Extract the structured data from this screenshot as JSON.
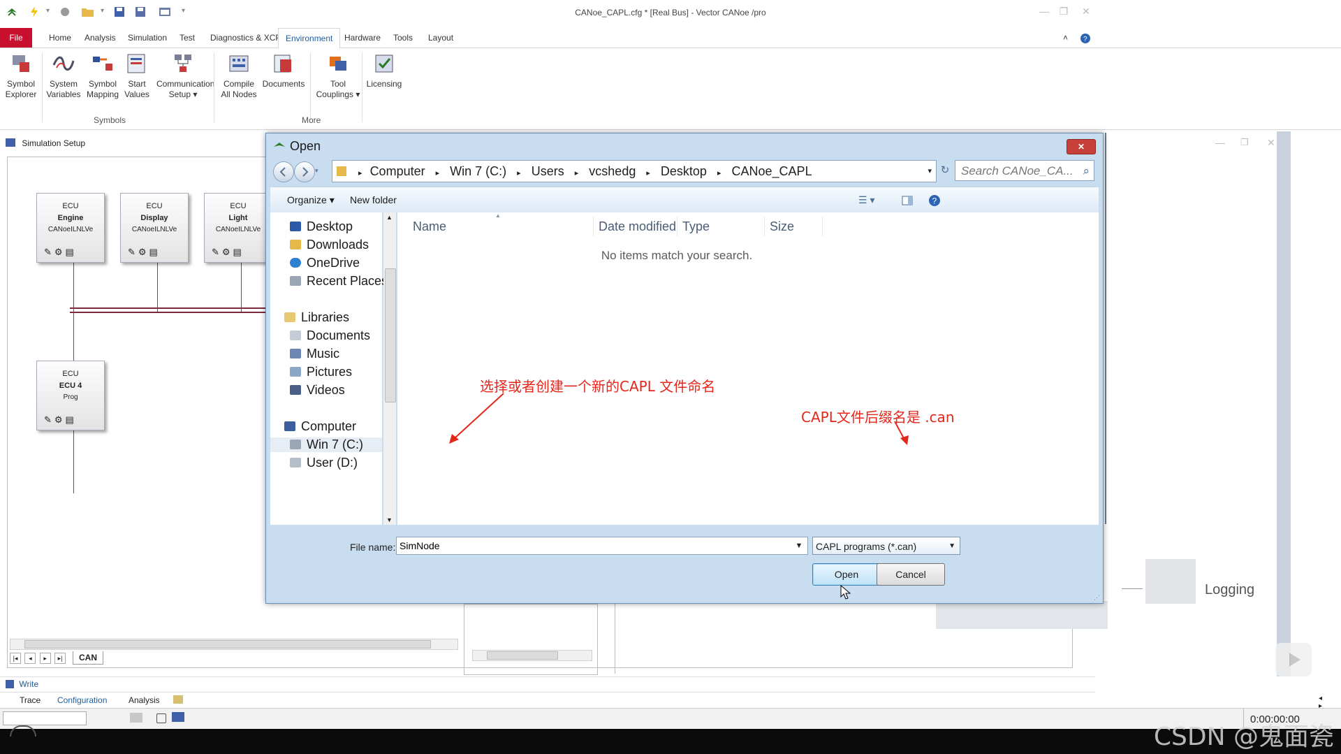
{
  "window": {
    "title": "CANoe_CAPL.cfg * [Real Bus] - Vector CANoe /pro"
  },
  "ribbon": {
    "tabs": [
      "File",
      "Home",
      "Analysis",
      "Simulation",
      "Test",
      "Diagnostics & XCP",
      "Environment",
      "Hardware",
      "Tools",
      "Layout"
    ],
    "buttons": [
      {
        "l1": "Symbol",
        "l2": "Explorer"
      },
      {
        "l1": "System",
        "l2": "Variables"
      },
      {
        "l1": "Symbol",
        "l2": "Mapping"
      },
      {
        "l1": "Start",
        "l2": "Values"
      },
      {
        "l1": "Communication",
        "l2": "Setup ▾"
      },
      {
        "l1": "Compile",
        "l2": "All Nodes"
      },
      {
        "l1": "Documents",
        "l2": ""
      },
      {
        "l1": "Tool",
        "l2": "Couplings ▾"
      },
      {
        "l1": "Licensing",
        "l2": ""
      }
    ],
    "groups": {
      "symbols": "Symbols",
      "more": "More"
    }
  },
  "sim": {
    "title": "Simulation Setup",
    "ecus": [
      {
        "l1": "ECU",
        "l2": "Engine",
        "l3": "CANoeILNLVe"
      },
      {
        "l1": "ECU",
        "l2": "Display",
        "l3": "CANoeILNLVe"
      },
      {
        "l1": "ECU",
        "l2": "Light",
        "l3": "CANoeILNLVe"
      },
      {
        "l1": "ECU",
        "l2": "ECU 4",
        "l3": "Prog"
      }
    ],
    "bus_tab": "CAN",
    "logging": "Logging"
  },
  "dialog": {
    "title": "Open",
    "breadcrumb": [
      "Computer",
      "Win 7 (C:)",
      "Users",
      "vcshedg",
      "Desktop",
      "CANoe_CAPL"
    ],
    "search_placeholder": "Search CANoe_CA...",
    "toolbar": {
      "organize": "Organize ▾",
      "new_folder": "New folder"
    },
    "nav_items": [
      "Desktop",
      "Downloads",
      "OneDrive",
      "Recent Places",
      "Libraries",
      "Documents",
      "Music",
      "Pictures",
      "Videos",
      "Computer",
      "Win 7 (C:)",
      "User (D:)"
    ],
    "columns": {
      "name": "Name",
      "date": "Date modified",
      "type": "Type",
      "size": "Size"
    },
    "empty_text": "No items match your search.",
    "file_name_label": "File name:",
    "file_name_value": "SimNode",
    "file_type": "CAPL programs (*.can)",
    "open_label": "Open",
    "cancel_label": "Cancel"
  },
  "annotations": {
    "a1": "选择或者创建一个新的CAPL 文件命名",
    "a2": "CAPL文件后缀名是 .can"
  },
  "bottom": {
    "write": "Write",
    "tabs": [
      "Trace",
      "Configuration",
      "Analysis"
    ],
    "time": "0:00:00:00"
  },
  "watermark": "CSDN @鬼面瓷",
  "colors": {
    "file_tab": "#c8102e",
    "annotation": "#e5271b",
    "accent": "#1f5c99"
  }
}
